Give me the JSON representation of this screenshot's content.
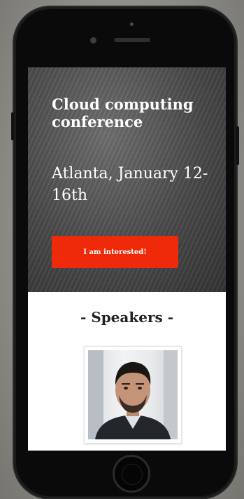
{
  "hero": {
    "title": "Cloud computing conference",
    "subtitle": "Atlanta, January 12-16th",
    "cta_label": "I am interested!"
  },
  "speakers": {
    "heading": "-  Speakers  -"
  },
  "colors": {
    "accent": "#ee2a0b",
    "hero_background": "#4a4a4a",
    "phone_body": "#0a0a0a"
  }
}
